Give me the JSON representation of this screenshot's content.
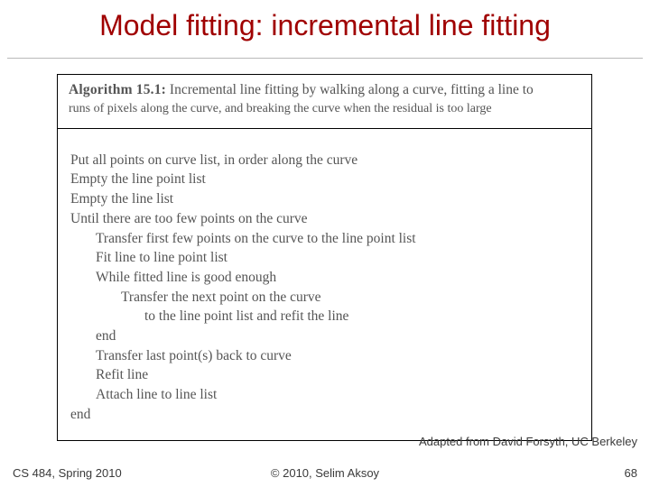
{
  "title": "Model fitting: incremental line fitting",
  "algorithm": {
    "label": "Algorithm 15.1:",
    "caption_line1": "Incremental line fitting by walking along a curve, fitting a line to",
    "caption_line2": "runs of pixels along the curve, and breaking the curve when the residual is too large",
    "lines": [
      {
        "indent": 0,
        "text": "Put all points on curve list, in order along the curve"
      },
      {
        "indent": 0,
        "text": "Empty the line point list"
      },
      {
        "indent": 0,
        "text": "Empty the line list"
      },
      {
        "indent": 0,
        "text": "Until there are too few points on the curve"
      },
      {
        "indent": 1,
        "text": "Transfer first few points on the curve to the line point list"
      },
      {
        "indent": 1,
        "text": "Fit line to line point list"
      },
      {
        "indent": 1,
        "text": "While fitted line is good enough"
      },
      {
        "indent": 2,
        "text": "Transfer the next point on the curve"
      },
      {
        "indent": 3,
        "text": "to the line point list and refit the line"
      },
      {
        "indent": 1,
        "text": "end"
      },
      {
        "indent": 1,
        "text": "Transfer last point(s) back to curve"
      },
      {
        "indent": 1,
        "text": "Refit line"
      },
      {
        "indent": 1,
        "text": "Attach line to line list"
      },
      {
        "indent": 0,
        "text": "end"
      }
    ]
  },
  "credit": "Adapted from David Forsyth, UC Berkeley",
  "footer": {
    "left": "CS 484, Spring 2010",
    "center": "© 2010, Selim Aksoy",
    "right": "68"
  }
}
